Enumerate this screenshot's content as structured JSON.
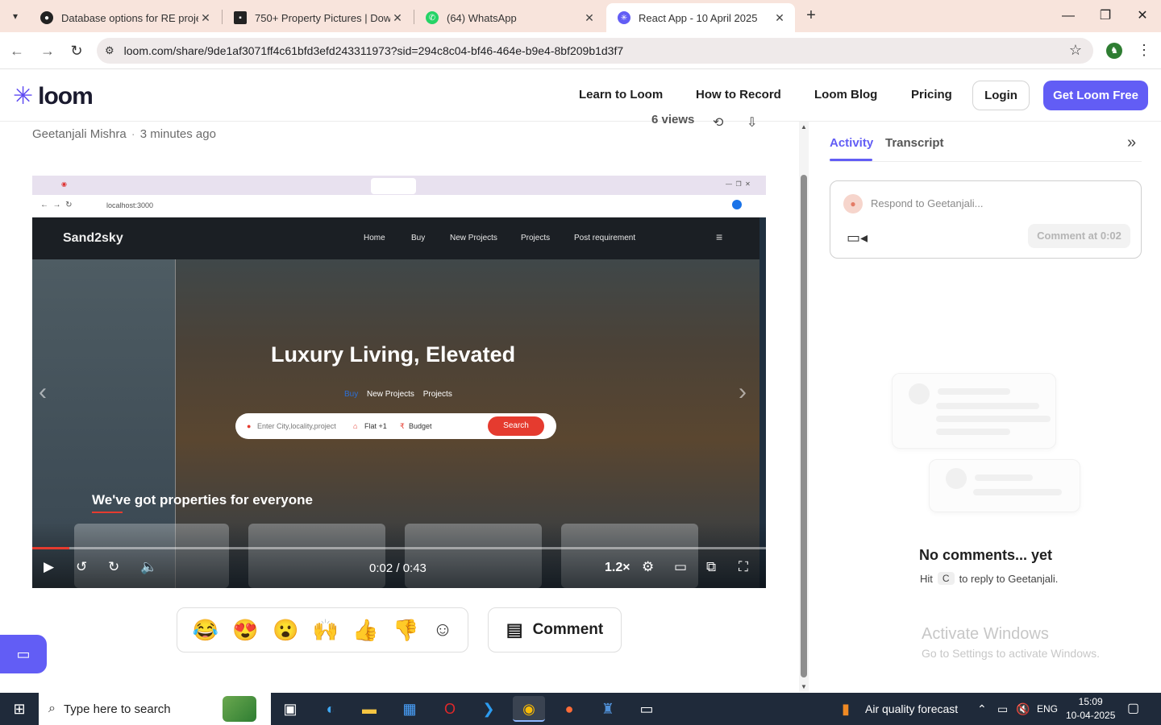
{
  "browser": {
    "tabs": [
      {
        "title": "Database options for RE project",
        "favicon": "github-icon",
        "color": "#222222"
      },
      {
        "title": "750+ Property Pictures | Downl",
        "favicon": "unsplash-icon",
        "color": "#222222"
      },
      {
        "title": "(64) WhatsApp",
        "favicon": "whatsapp-icon",
        "color": "#25d366"
      },
      {
        "title": "React App - 10 April 2025",
        "favicon": "loom-icon",
        "color": "#625df5"
      }
    ],
    "url": "loom.com/share/9de1af3071ff4c61bfd3efd243311973?sid=294c8c04-bf46-464e-b9e4-8bf209b1d3f7"
  },
  "loom": {
    "logo_text": "loom",
    "nav": [
      "Learn to Loom",
      "How to Record",
      "Loom Blog",
      "Pricing"
    ],
    "login": "Login",
    "cta": "Get Loom Free",
    "author": "Geetanjali Mishra",
    "time_ago": "3 minutes ago",
    "views": "6 views",
    "accent": "#625df5"
  },
  "video": {
    "inner_url": "localhost:3000",
    "site_brand": "Sand2sky",
    "site_nav": [
      "Home",
      "Buy",
      "New Projects",
      "Projects",
      "Post requirement"
    ],
    "hero_title": "Luxury Living, Elevated",
    "hero_tabs": [
      "Buy",
      "New Projects",
      "Projects"
    ],
    "search_location": "Enter City,locality,project",
    "search_type": "Flat +1",
    "search_budget": "Budget",
    "search_button": "Search",
    "subtitle": "We've got properties for everyone",
    "current_time": "0:02",
    "duration": "0:43",
    "time_display": "0:02 / 0:43",
    "speed": "1.2×",
    "progress_fraction": 0.05
  },
  "reactions": [
    "😂",
    "😍",
    "😮",
    "🙌",
    "👍",
    "👎"
  ],
  "comment_label": "Comment",
  "panel": {
    "tab_activity": "Activity",
    "tab_transcript": "Transcript",
    "respond_placeholder": "Respond to Geetanjali...",
    "comment_at": "Comment at 0:02",
    "empty_title": "No comments... yet",
    "hint_prefix": "Hit",
    "hint_key": "C",
    "hint_suffix": "to reply to Geetanjali."
  },
  "watermark": {
    "line1": "Activate Windows",
    "line2": "Go to Settings to activate Windows."
  },
  "taskbar": {
    "search_placeholder": "Type here to search",
    "weather": "Air quality forecast",
    "lang": "ENG",
    "time": "15:09",
    "date": "10-04-2025"
  }
}
